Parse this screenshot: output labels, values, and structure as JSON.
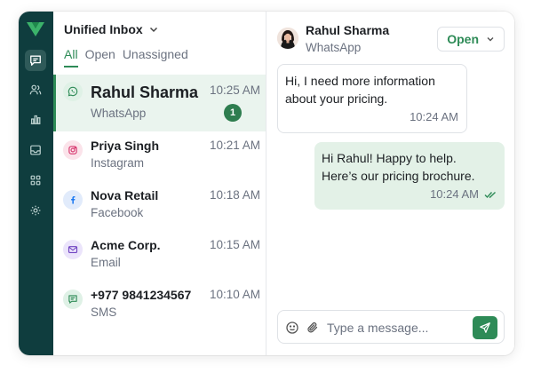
{
  "colors": {
    "rail": "#0f3d3e",
    "accent": "#2e8b57",
    "selected_row": "#eaf4ee",
    "outgoing_bubble": "#e3f1e7"
  },
  "rail": {
    "icons": [
      "brand-logo-icon",
      "chat-icon",
      "contacts-icon",
      "analytics-icon",
      "inbox-icon",
      "apps-grid-icon",
      "settings-icon"
    ],
    "active": "chat-icon"
  },
  "inbox": {
    "title": "Unified Inbox",
    "tabs": [
      {
        "label": "All",
        "active": true
      },
      {
        "label": "Open",
        "active": false
      },
      {
        "label": "Unassigned",
        "active": false
      }
    ],
    "conversations": [
      {
        "name": "Rahul Sharma",
        "channel": "WhatsApp",
        "time": "10:25 AM",
        "unread": "1",
        "icon": "whatsapp-icon",
        "selected": true
      },
      {
        "name": "Priya Singh",
        "channel": "Instagram",
        "time": "10:21 AM",
        "icon": "instagram-icon"
      },
      {
        "name": "Nova Retail",
        "channel": "Facebook",
        "time": "10:18 AM",
        "icon": "facebook-icon"
      },
      {
        "name": "Acme Corp.",
        "channel": "Email",
        "time": "10:15 AM",
        "icon": "email-icon"
      },
      {
        "name": "+977 9841234567",
        "channel": "SMS",
        "time": "10:10 AM",
        "icon": "sms-icon"
      }
    ]
  },
  "chat": {
    "contact_name": "Rahul Sharma",
    "contact_channel": "WhatsApp",
    "status": "Open",
    "messages": [
      {
        "direction": "in",
        "lines": [
          "Hi, I need more information",
          "about your pricing."
        ],
        "time": "10:24 AM"
      },
      {
        "direction": "out",
        "lines": [
          "Hi Rahul! Happy to help.",
          "Here’s our pricing brochure."
        ],
        "time": "10:24 AM",
        "read": true
      }
    ],
    "composer": {
      "placeholder": "Type a message..."
    }
  }
}
